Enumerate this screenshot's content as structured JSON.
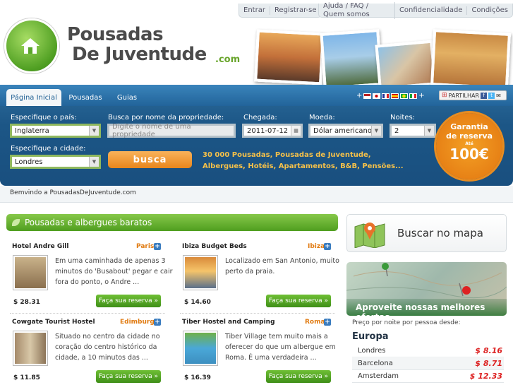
{
  "toplinks": {
    "login": "Entrar",
    "register": "Registrar-se",
    "help": "Ajuda / FAQ / Quem somos",
    "privacy": "Confidencialidade",
    "terms": "Condições"
  },
  "logo": {
    "line1": "Pousadas",
    "line2": "De Juventude",
    "tld": ".com"
  },
  "tabs": [
    "Página Inicial",
    "Pousadas",
    "Guias"
  ],
  "share_label": "PARTILHAR",
  "search": {
    "country_label": "Especifique o país:",
    "country_value": "Inglaterra",
    "property_label": "Busca por nome da propriedade:",
    "property_placeholder": "Digite o nome de uma propriedade",
    "arrival_label": "Chegada:",
    "arrival_value": "2011-07-12",
    "currency_label": "Moeda:",
    "currency_value": "Dólar americano",
    "nights_label": "Noites:",
    "nights_value": "2",
    "city_label": "Especifique a cidade:",
    "city_value": "Londres",
    "button": "busca",
    "promo": "30 000 Pousadas, Pousadas de Juventude, Albergues, Hotéis, Apartamentos, B&B, Pensões..."
  },
  "badge": {
    "line1": "Garantia",
    "line2": "de reserva",
    "line3": "Até",
    "amount": "100€"
  },
  "welcome": "Bemvindo a PousadasDeJuventude.com",
  "section_title": "Pousadas e albergues baratos",
  "reserve_label": "Faça sua reserva »",
  "hostels": [
    {
      "name": "Hotel Andre Gill",
      "city": "Paris",
      "desc": [
        "Em uma caminhada de apenas 3",
        "minutos do 'Busabout' pegar e cair",
        "fora do ponto, o Andre ..."
      ],
      "price": "$ 28.31"
    },
    {
      "name": "Ibiza Budget Beds",
      "city": "Ibiza",
      "desc": [
        "Localizado em San Antonio, muito",
        "perto da praia."
      ],
      "price": "$ 14.60"
    },
    {
      "name": "Cowgate Tourist Hostel",
      "city": "Edimburgo",
      "desc": [
        "Situado no centro da cidade no",
        "coração do centro histórico da",
        "cidade, a 10 minutos das ..."
      ],
      "price": "$ 11.85"
    },
    {
      "name": "Tiber Hostel and Camping",
      "city": "Roma",
      "desc": [
        "Tiber Village tem muito mais a",
        "oferecer do que um albergue em",
        "Roma. É uma verdadeira ..."
      ],
      "price": "$ 16.39"
    }
  ],
  "map_button": "Buscar no mapa",
  "offers_label": "Aproveite nossas melhores ofertas",
  "price_note": "Preço por noite por pessoa desde:",
  "region": "Europa",
  "cities": [
    {
      "name": "Londres",
      "price": "$ 8.16"
    },
    {
      "name": "Barcelona",
      "price": "$ 8.71"
    },
    {
      "name": "Amsterdam",
      "price": "$ 12.33"
    }
  ]
}
